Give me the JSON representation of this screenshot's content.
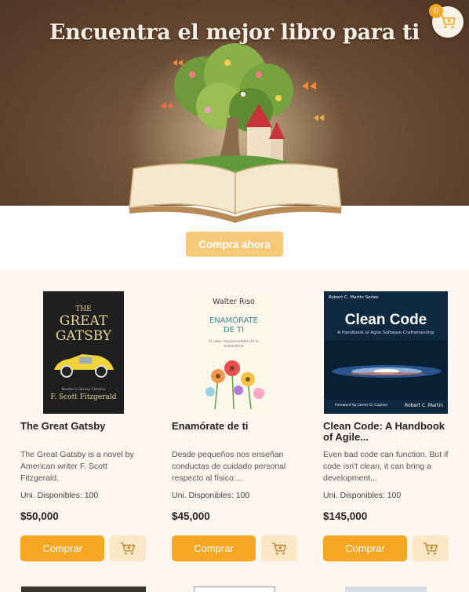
{
  "hero": {
    "title": "Encuentra el mejor libro para ti",
    "cta_label": "Compra ahora"
  },
  "cart": {
    "count": "0",
    "icon": "cart-plus-icon"
  },
  "colors": {
    "accent": "#f5a623",
    "accent_light": "#fbe6c6",
    "hero_bg": "#5e4330",
    "section_bg": "#fdf6ee"
  },
  "products": [
    {
      "title": "The Great Gatsby",
      "description": "The Great Gatsby is a novel by American writer F. Scott Fitzgerald.",
      "stock": "Uni. Disponibles: 100",
      "price": "$50,000",
      "buy_label": "Comprar",
      "cover": {
        "title_line1": "THE",
        "title_line2": "GREAT",
        "title_line3": "GATSBY",
        "subtitle": "Reader's Library Classics",
        "author": "F. Scott Fitzgerald"
      }
    },
    {
      "title": "Enamórate de ti",
      "description": "Desde pequeños nos enseñan conductas de cuidado personal respecto al físico:...",
      "stock": "Uni. Disponibles: 100",
      "price": "$45,000",
      "buy_label": "Comprar",
      "cover": {
        "author": "Walter Riso",
        "title_line1": "ENAMÓRATE",
        "title_line2": "DE TI",
        "subtitle": "El valor imprescindible de la autoestima"
      }
    },
    {
      "title": "Clean Code: A Handbook of Agile...",
      "description": "Even bad code can function. But if code isn't clean, it can bring a development...",
      "stock": "Uni. Disponibles: 100",
      "price": "$145,000",
      "buy_label": "Comprar",
      "cover": {
        "series": "Robert C. Martin Series",
        "title": "Clean Code",
        "subtitle": "A Handbook of Agile Software Craftsmanship",
        "foreword": "Foreword by James O. Coplien",
        "author": "Robert C. Martin"
      }
    }
  ]
}
